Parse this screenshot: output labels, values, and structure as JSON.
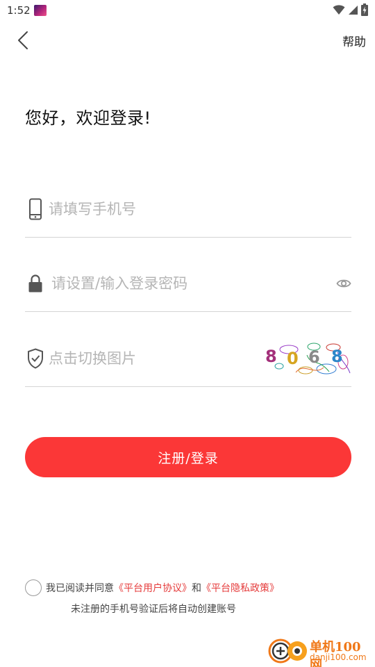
{
  "status_bar": {
    "time": "1:52",
    "app_icon": "app-thumbnail-icon",
    "icons": [
      "wifi-icon",
      "signal-icon",
      "battery-charging-icon"
    ]
  },
  "nav": {
    "back_icon": "chevron-left-icon",
    "help_label": "帮助"
  },
  "greeting": "您好，欢迎登录!",
  "form": {
    "phone": {
      "icon": "phone-icon",
      "value": "",
      "placeholder": "请填写手机号"
    },
    "password": {
      "icon": "lock-icon",
      "value": "",
      "placeholder": "请设置/输入登录密码",
      "toggle_icon": "eye-icon"
    },
    "captcha": {
      "icon": "shield-check-icon",
      "value": "",
      "placeholder": "点击切换图片",
      "image_text": "8068"
    },
    "submit_label": "注册/登录"
  },
  "agreement": {
    "checked": false,
    "prefix": "我已阅读并同意",
    "platform_agreement": "《平台用户协议》",
    "and": "和",
    "privacy_policy": "《平台隐私政策》",
    "note": "未注册的手机号验证后将自动创建账号"
  },
  "watermark": {
    "title": "单机100网",
    "site": "danji100.com"
  },
  "colors": {
    "accent": "#fb3737",
    "link": "#e53b3b",
    "watermark": "#f07818",
    "placeholder": "#b5b5b5",
    "divider": "#d4d4d4"
  }
}
